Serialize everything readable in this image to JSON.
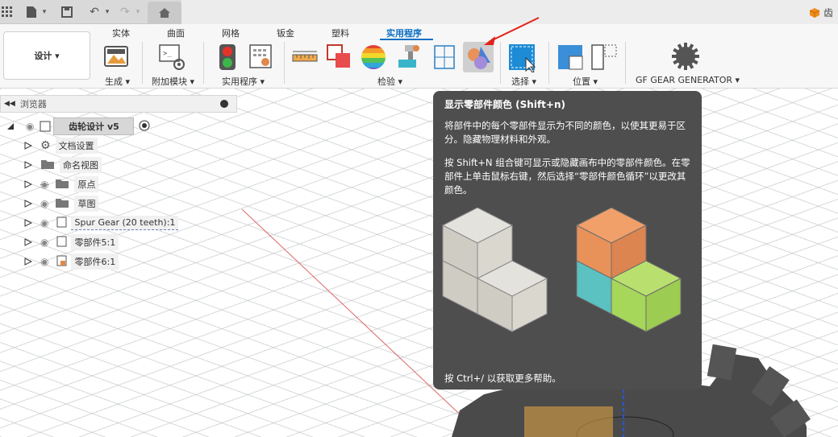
{
  "quickbar": {
    "doc_name_partial": "齿"
  },
  "ribbon": {
    "workspace_label": "设计 ▾",
    "tabs": [
      "实体",
      "曲面",
      "网格",
      "钣金",
      "塑料",
      "实用程序"
    ],
    "active_tab": "实用程序",
    "groups": {
      "create": "生成 ▾",
      "addins": "附加模块 ▾",
      "utilities": "实用程序 ▾",
      "inspect": "检验 ▾",
      "select": "选择 ▾",
      "position": "位置 ▾",
      "gear": "GF GEAR GENERATOR ▾"
    }
  },
  "browser": {
    "title": "浏览器",
    "root": "齿轮设计 v5",
    "items": [
      {
        "label": "文档设置",
        "icon": "gear-icon"
      },
      {
        "label": "命名视图",
        "icon": "folder-icon"
      },
      {
        "label": "原点",
        "icon": "folder-icon"
      },
      {
        "label": "草图",
        "icon": "folder-icon"
      },
      {
        "label": "Spur Gear (20 teeth):1",
        "icon": "component-icon"
      },
      {
        "label": "零部件5:1",
        "icon": "component-icon"
      },
      {
        "label": "零部件6:1",
        "icon": "component-icon"
      }
    ]
  },
  "tooltip": {
    "title": "显示零部件颜色 (Shift+n)",
    "para1": "将部件中的每个零部件显示为不同的颜色，以使其更易于区分。隐藏物理材料和外观。",
    "para2": "按 Shift+N 组合键可显示或隐藏画布中的零部件颜色。在零部件上单击鼠标右键，然后选择“零部件颜色循环”以更改其颜色。",
    "footer": "按 Ctrl+/ 以获取更多帮助。"
  },
  "colors": {
    "accent": "#0b6fc4",
    "tooltip_bg": "#4e4e4e",
    "cube_orange": "#e8925a",
    "cube_teal": "#5bc1c1",
    "cube_green": "#a6d65a"
  }
}
